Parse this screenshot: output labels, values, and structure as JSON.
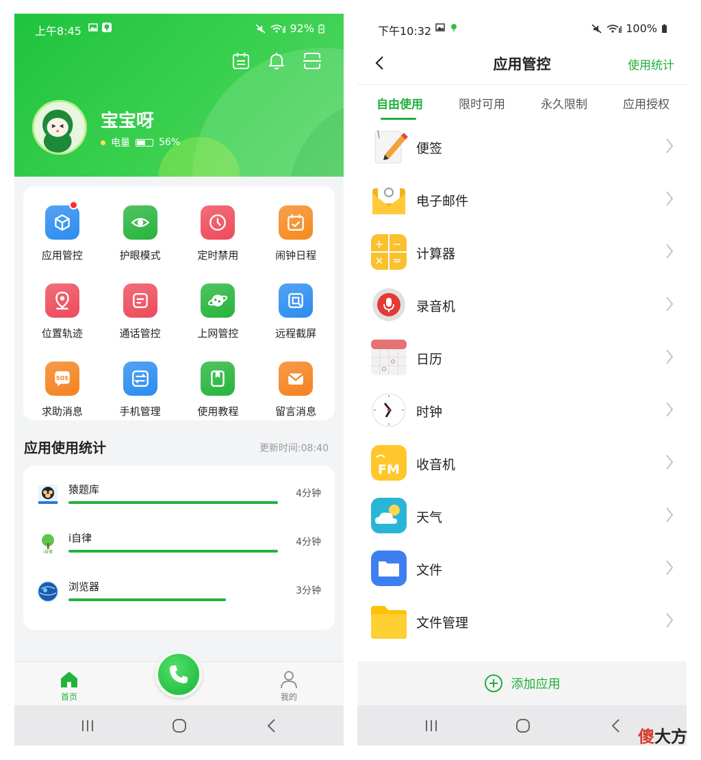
{
  "left": {
    "status": {
      "time": "上午8:45",
      "battery": "92%"
    },
    "profile": {
      "name": "宝宝呀",
      "battery_label": "电量",
      "battery_value": "56%",
      "battery_level": 0.56
    },
    "grid": [
      {
        "label": "应用管控",
        "icon": "cube-icon",
        "color": "#2a8cf0",
        "badge": true
      },
      {
        "label": "护眼模式",
        "icon": "eye-icon",
        "color": "#26b43c"
      },
      {
        "label": "定时禁用",
        "icon": "clock-icon",
        "color": "#ee4a5a"
      },
      {
        "label": "闹钟日程",
        "icon": "calendar-check-icon",
        "color": "#f58a1f"
      },
      {
        "label": "位置轨迹",
        "icon": "location-pin-icon",
        "color": "#ee4a5a"
      },
      {
        "label": "通话管控",
        "icon": "message-icon",
        "color": "#ee4a5a"
      },
      {
        "label": "上网管控",
        "icon": "planet-icon",
        "color": "#26b43c"
      },
      {
        "label": "远程截屏",
        "icon": "screenshot-icon",
        "color": "#2a8cf0"
      },
      {
        "label": "求助消息",
        "icon": "sos-icon",
        "color": "#f5821f"
      },
      {
        "label": "手机管理",
        "icon": "transfer-icon",
        "color": "#2a8cf0"
      },
      {
        "label": "使用教程",
        "icon": "book-icon",
        "color": "#26b43c"
      },
      {
        "label": "留言消息",
        "icon": "mail-icon",
        "color": "#f5821f"
      }
    ],
    "usage": {
      "title": "应用使用统计",
      "updated": "更新时间:08:40",
      "items": [
        {
          "name": "猿题库",
          "time": "4分钟",
          "fraction": 1.0
        },
        {
          "name": "i自律",
          "time": "4分钟",
          "fraction": 1.0
        },
        {
          "name": "浏览器",
          "time": "3分钟",
          "fraction": 0.75
        }
      ]
    },
    "tabbar": {
      "home": "首页",
      "mine": "我的"
    }
  },
  "right": {
    "status": {
      "time": "下午10:32",
      "battery": "100%"
    },
    "title": "应用管控",
    "stats_link": "使用统计",
    "tabs": [
      "自由使用",
      "限时可用",
      "永久限制",
      "应用授权"
    ],
    "active_tab": "自由使用",
    "apps": [
      {
        "name": "便签",
        "icon": "memo-icon"
      },
      {
        "name": "电子邮件",
        "icon": "email-icon"
      },
      {
        "name": "计算器",
        "icon": "calculator-icon"
      },
      {
        "name": "录音机",
        "icon": "recorder-icon"
      },
      {
        "name": "日历",
        "icon": "calendar-icon"
      },
      {
        "name": "时钟",
        "icon": "clock-app-icon"
      },
      {
        "name": "收音机",
        "icon": "radio-icon"
      },
      {
        "name": "天气",
        "icon": "weather-icon"
      },
      {
        "name": "文件",
        "icon": "files-icon"
      },
      {
        "name": "文件管理",
        "icon": "folder-icon"
      }
    ],
    "add_label": "添加应用"
  },
  "watermark": {
    "red": "傻",
    "black": "大方"
  },
  "colors": {
    "brand_green": "#1fae3a",
    "header_green": "#2dc944"
  }
}
